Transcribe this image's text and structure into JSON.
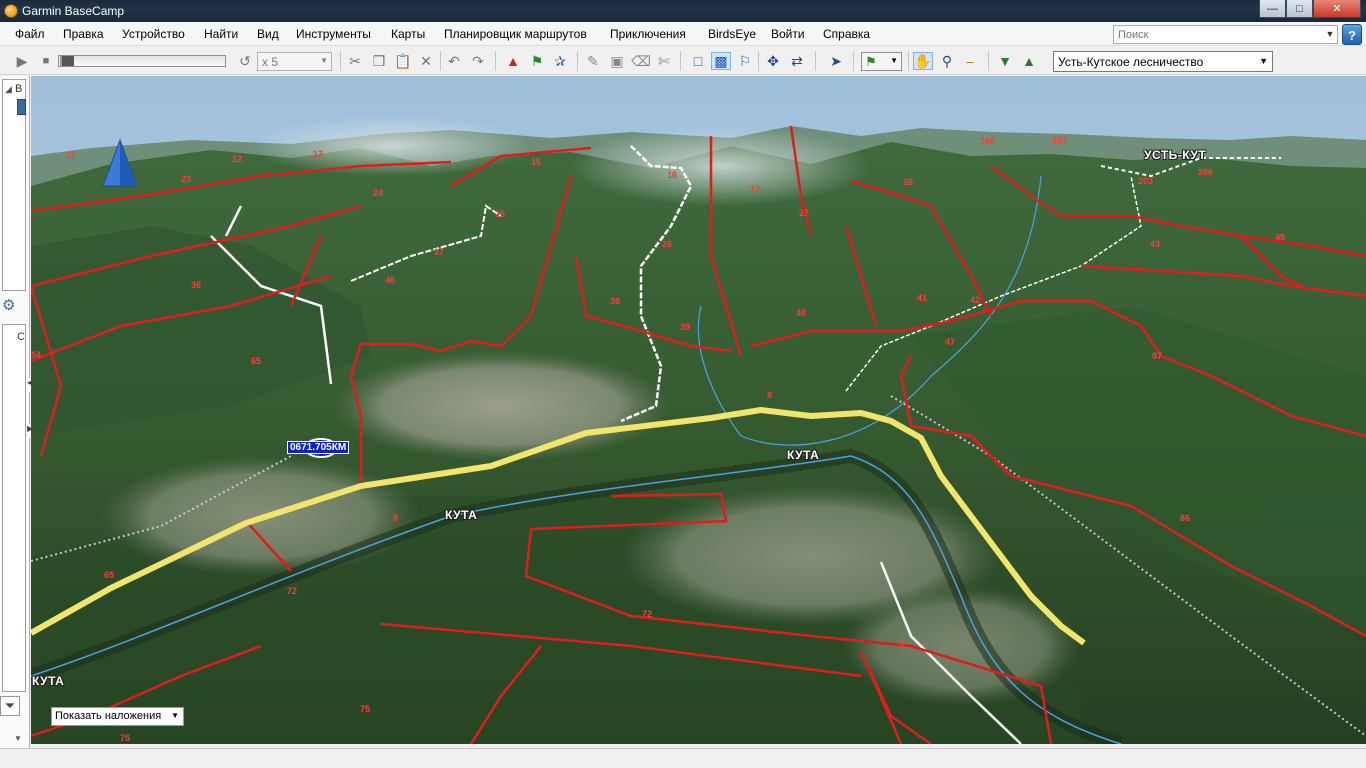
{
  "window": {
    "title": "Garmin BaseCamp"
  },
  "menu": [
    "Файл",
    "Правка",
    "Устройство",
    "Найти",
    "Вид",
    "Инструменты",
    "Карты",
    "Планировщик маршрутов",
    "Приключения",
    "BirdsEye",
    "Войти",
    "Справка"
  ],
  "search": {
    "placeholder": "Поиск"
  },
  "toolbar": {
    "speed_value": "x 5",
    "map_product": "Усть-Кутское лесничество"
  },
  "map": {
    "place_labels": [
      "УСТЬ-КУТ",
      "КУТА",
      "КУТА",
      "КУТА"
    ],
    "waypoint_label": "0671.705КМ",
    "overlay_button": "Показать наложения",
    "parcel_numbers": [
      "11",
      "12",
      "13",
      "15",
      "16",
      "17",
      "186",
      "187",
      "23",
      "24",
      "25",
      "26",
      "27",
      "28",
      "203",
      "206",
      "36",
      "37",
      "38",
      "39",
      "40",
      "41",
      "42",
      "43",
      "46",
      "47",
      "49",
      "54",
      "65",
      "87",
      "8",
      "8",
      "72",
      "72",
      "65",
      "86",
      "0",
      "75",
      "75"
    ]
  },
  "left_panel": {
    "letters": [
      "B",
      "C"
    ]
  }
}
